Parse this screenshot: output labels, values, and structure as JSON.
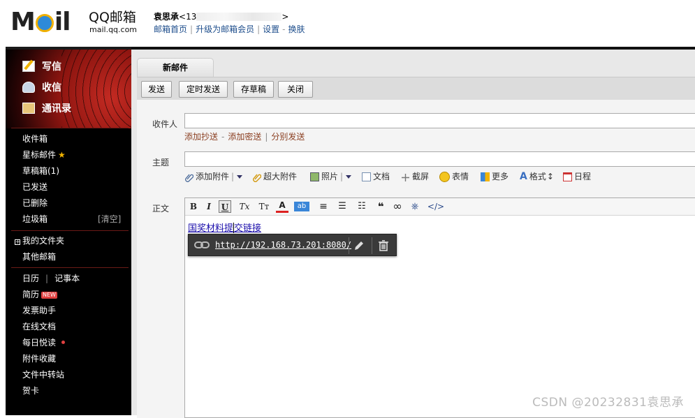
{
  "header": {
    "logo_text": "MOil",
    "brand_name": "QQ邮箱",
    "brand_url": "mail.qq.com",
    "user_name": "袁思承",
    "user_email_prefix": "<13",
    "user_email_suffix": ">",
    "links": [
      "邮箱首页",
      "升级为邮箱会员",
      "设置",
      "换肤"
    ]
  },
  "sidebar": {
    "compose_label": "写信",
    "receive_label": "收信",
    "contacts_label": "通讯录",
    "folders": [
      {
        "label": "收件箱"
      },
      {
        "label": "星标邮件",
        "star": "★"
      },
      {
        "label": "草稿箱(1)"
      },
      {
        "label": "已发送"
      },
      {
        "label": "已删除"
      },
      {
        "label": "垃圾箱",
        "action": "[清空]"
      }
    ],
    "my_folders_label": "我的文件夹",
    "other_mailbox_label": "其他邮箱",
    "apps": [
      {
        "label": "日历"
      },
      {
        "label": "记事本"
      },
      {
        "label": "简历",
        "badge": "NEW"
      },
      {
        "label": "发票助手"
      },
      {
        "label": "在线文档"
      },
      {
        "label": "每日悦读"
      },
      {
        "label": "附件收藏"
      },
      {
        "label": "文件中转站"
      },
      {
        "label": "贺卡"
      }
    ],
    "calendar_sep": "|"
  },
  "compose": {
    "tab_label": "新邮件",
    "toolbar": {
      "send": "发送",
      "scheduled_send": "定时发送",
      "save_draft": "存草稿",
      "close": "关闭"
    },
    "to_label": "收件人",
    "to_value": "",
    "sublinks": [
      "添加抄送",
      "添加密送",
      "分别发送"
    ],
    "subject_label": "主题",
    "subject_value": "",
    "attach_bar": [
      "添加附件",
      "超大附件",
      "照片",
      "文档",
      "截屏",
      "表情",
      "更多",
      "格式",
      "日程"
    ],
    "body_label": "正文",
    "editor_tools": [
      "B",
      "I",
      "U",
      "Tx",
      "Tт",
      "A",
      "ab",
      "≡",
      "☰",
      "☷",
      "❝",
      "∞",
      "⎈",
      "</>"
    ],
    "body_link_text": "国奖材料提交链接",
    "link_popup_url": "http://192.168.73.201:8080/"
  },
  "watermark": "CSDN @20232831袁思承",
  "colors": {
    "accent_link": "#1a0dab",
    "sidebar_bg": "#000000",
    "sublink": "#8a3e20"
  }
}
